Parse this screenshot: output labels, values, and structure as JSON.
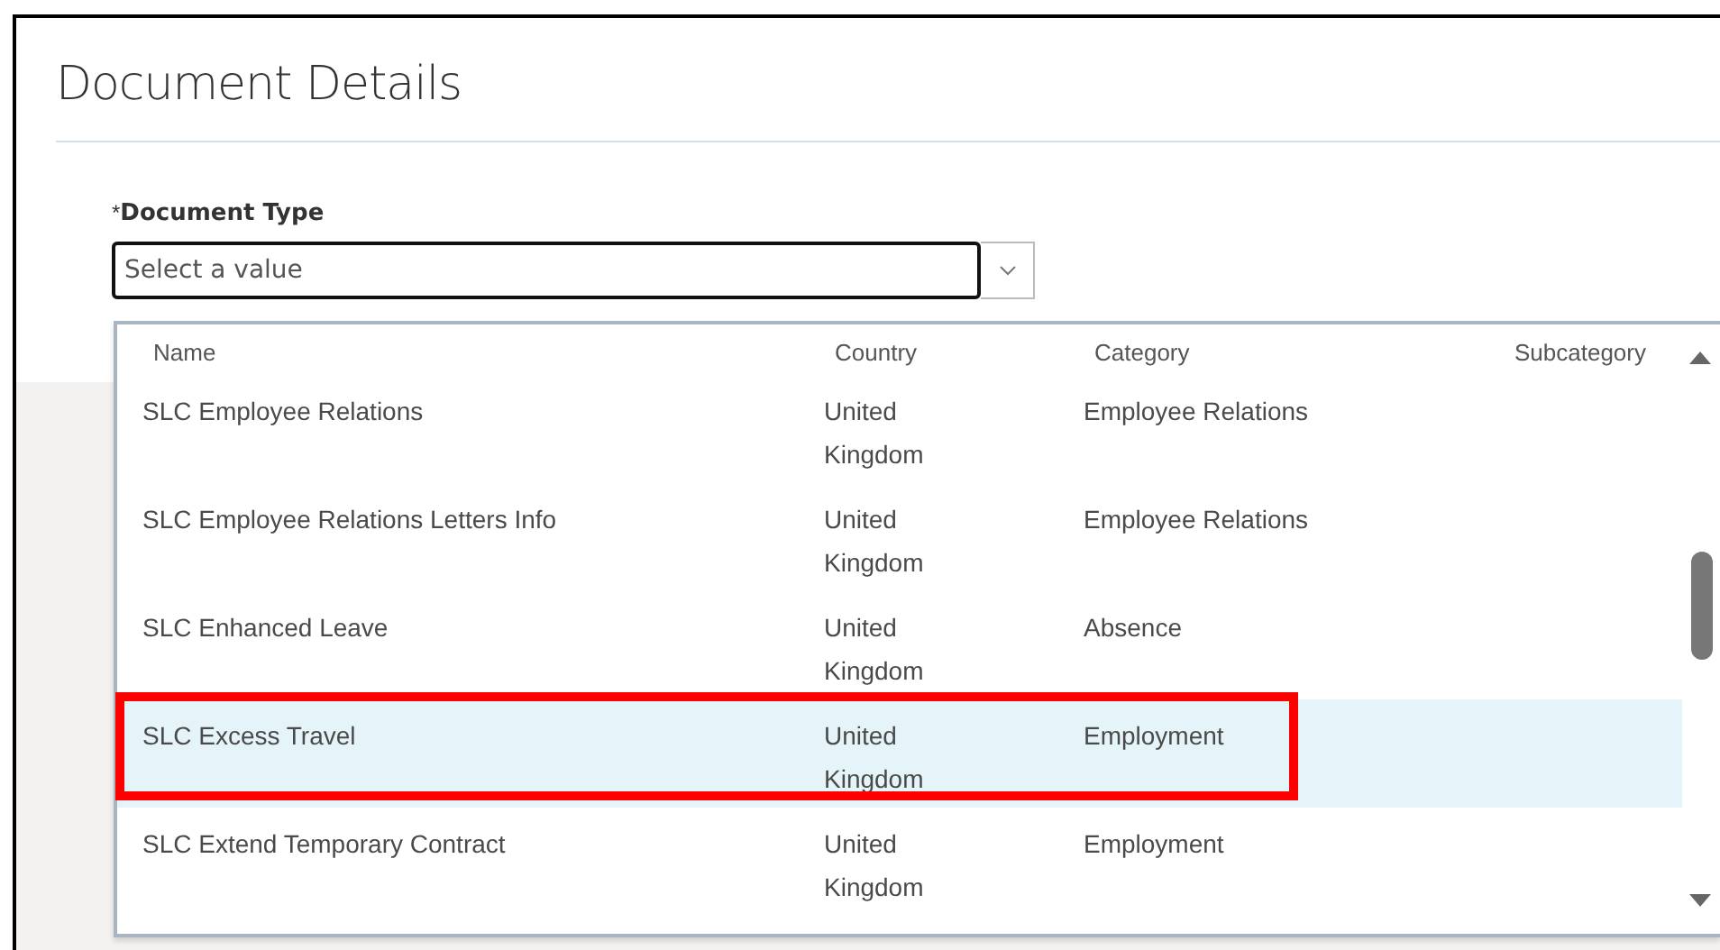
{
  "page": {
    "title": "Document Details"
  },
  "field": {
    "required_mark": "*",
    "label": "Document Type",
    "placeholder": "Select a value"
  },
  "dropdown": {
    "columns": [
      "Name",
      "Country",
      "Category",
      "Subcategory"
    ],
    "rows": [
      {
        "name": "SLC Employee Relations",
        "country": "United Kingdom",
        "category": "Employee Relations",
        "selected": false,
        "highlighted": false
      },
      {
        "name": "SLC Employee Relations Letters Info",
        "country": "United Kingdom",
        "category": "Employee Relations",
        "selected": false,
        "highlighted": false
      },
      {
        "name": "SLC Enhanced Leave",
        "country": "United Kingdom",
        "category": "Absence",
        "selected": false,
        "highlighted": false
      },
      {
        "name": "SLC Excess Travel",
        "country": "United Kingdom",
        "category": "Employment",
        "selected": true,
        "highlighted": true
      },
      {
        "name": "SLC Extend Temporary Contract",
        "country": "United Kingdom",
        "category": "Employment",
        "selected": false,
        "highlighted": false
      }
    ]
  }
}
